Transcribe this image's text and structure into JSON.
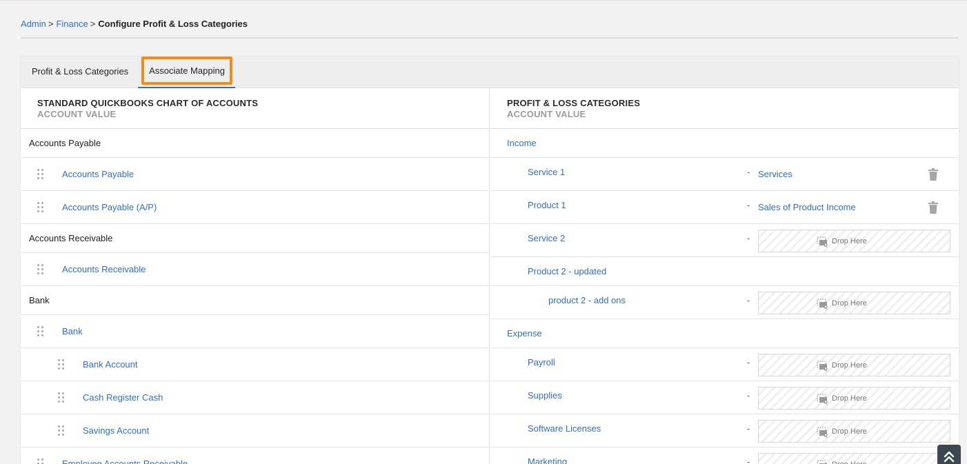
{
  "breadcrumb": {
    "items": [
      "Admin",
      "Finance"
    ],
    "separator": ">",
    "current": "Configure Profit & Loss Categories"
  },
  "tabs": [
    {
      "label": "Profit & Loss Categories",
      "active": false
    },
    {
      "label": "Associate Mapping",
      "active": true
    }
  ],
  "left": {
    "title": "STANDARD QUICKBOOKS CHART OF ACCOUNTS",
    "subtitle": "ACCOUNT VALUE",
    "rows": [
      {
        "type": "group",
        "label": "Accounts Payable"
      },
      {
        "type": "item",
        "label": "Accounts Payable",
        "level": 1
      },
      {
        "type": "item",
        "label": "Accounts Payable (A/P)",
        "level": 1
      },
      {
        "type": "group",
        "label": "Accounts Receivable"
      },
      {
        "type": "item",
        "label": "Accounts Receivable",
        "level": 1
      },
      {
        "type": "group",
        "label": "Bank"
      },
      {
        "type": "item",
        "label": "Bank",
        "level": 1
      },
      {
        "type": "item",
        "label": "Bank Account",
        "level": 2
      },
      {
        "type": "item",
        "label": "Cash Register Cash",
        "level": 2
      },
      {
        "type": "item",
        "label": "Savings Account",
        "level": 2
      },
      {
        "type": "item",
        "label": "Employee Accounts Receivable",
        "level": 1
      }
    ]
  },
  "right": {
    "title": "PROFIT & LOSS CATEGORIES",
    "subtitle": "ACCOUNT VALUE",
    "dash": "-",
    "drop_label": "Drop Here",
    "rows": [
      {
        "type": "category",
        "label": "Income"
      },
      {
        "type": "map",
        "label": "Service 1",
        "level": 1,
        "mapped": "Services"
      },
      {
        "type": "map",
        "label": "Product 1",
        "level": 1,
        "mapped": "Sales of Product Income"
      },
      {
        "type": "map",
        "label": "Service 2",
        "level": 1,
        "mapped": null
      },
      {
        "type": "sub",
        "label": "Product 2 - updated",
        "level": 1
      },
      {
        "type": "map",
        "label": "product 2 - add ons",
        "level": 2,
        "mapped": null
      },
      {
        "type": "category",
        "label": "Expense"
      },
      {
        "type": "map",
        "label": "Payroll",
        "level": 1,
        "mapped": null
      },
      {
        "type": "map",
        "label": "Supplies",
        "level": 1,
        "mapped": null
      },
      {
        "type": "map",
        "label": "Software Licenses",
        "level": 1,
        "mapped": null
      },
      {
        "type": "map",
        "label": "Marketing",
        "level": 1,
        "mapped": null
      }
    ]
  },
  "colors": {
    "link": "#2f6fc6",
    "highlight": "#f28c1c",
    "tab_underline": "#2f6fc6",
    "scroll_button": "#3b4650"
  },
  "icons": {
    "drag": "drag-handle-icon",
    "trash": "trash-icon",
    "drop": "drop-here-icon",
    "scroll_top": "double-chevron-up-icon"
  }
}
